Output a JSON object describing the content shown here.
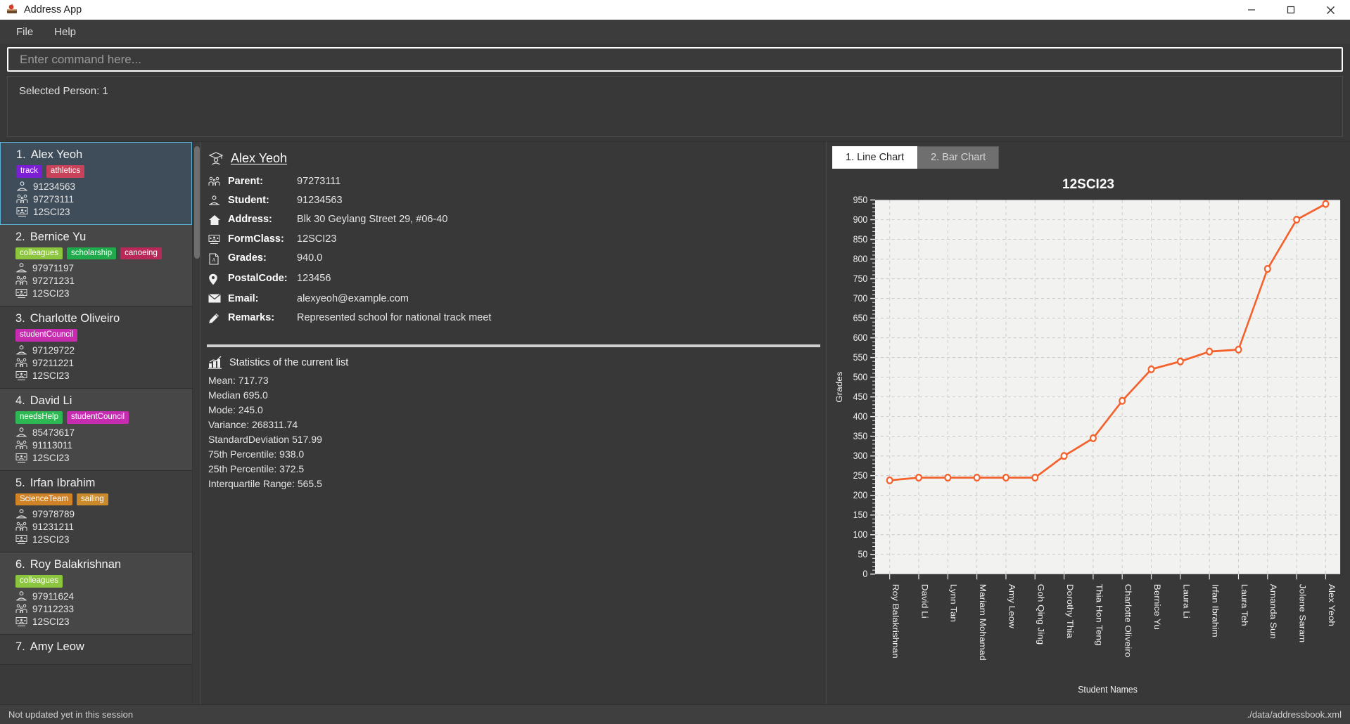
{
  "window": {
    "title": "Address App",
    "app_icon": "book-apple-icon",
    "buttons": {
      "minimize": "—",
      "maximize": "❐",
      "close": "✕"
    }
  },
  "menubar": {
    "items": [
      {
        "label": "File"
      },
      {
        "label": "Help"
      }
    ]
  },
  "command_box": {
    "placeholder": "Enter command here...",
    "value": ""
  },
  "result_box": {
    "text": "Selected Person: 1"
  },
  "person_list": {
    "scroll_position": "top",
    "items": [
      {
        "index": "1.",
        "name": "Alex Yeoh",
        "selected": true,
        "tags": [
          {
            "label": "track",
            "color": "#7c1fd4"
          },
          {
            "label": "athletics",
            "color": "#c8435a"
          }
        ],
        "student_phone": "91234563",
        "parent_phone": "97273111",
        "form_class": "12SCI23"
      },
      {
        "index": "2.",
        "name": "Bernice Yu",
        "selected": false,
        "tags": [
          {
            "label": "colleagues",
            "color": "#8cc63f"
          },
          {
            "label": "scholarship",
            "color": "#1faa4b"
          },
          {
            "label": "canoeing",
            "color": "#b8295a"
          }
        ],
        "student_phone": "97971197",
        "parent_phone": "97271231",
        "form_class": "12SCI23"
      },
      {
        "index": "3.",
        "name": "Charlotte Oliveiro",
        "selected": false,
        "tags": [
          {
            "label": "studentCouncil",
            "color": "#c62bb0"
          }
        ],
        "student_phone": "97129722",
        "parent_phone": "97211221",
        "form_class": "12SCI23"
      },
      {
        "index": "4.",
        "name": "David Li",
        "selected": false,
        "tags": [
          {
            "label": "needsHelp",
            "color": "#2eb853"
          },
          {
            "label": "studentCouncil",
            "color": "#c62bb0"
          }
        ],
        "student_phone": "85473617",
        "parent_phone": "91113011",
        "form_class": "12SCI23"
      },
      {
        "index": "5.",
        "name": "Irfan Ibrahim",
        "selected": false,
        "tags": [
          {
            "label": "ScienceTeam",
            "color": "#cf8326"
          },
          {
            "label": "sailing",
            "color": "#c98a2b"
          }
        ],
        "student_phone": "97978789",
        "parent_phone": "91231211",
        "form_class": "12SCI23"
      },
      {
        "index": "6.",
        "name": "Roy Balakrishnan",
        "selected": false,
        "tags": [
          {
            "label": "colleagues",
            "color": "#8cc63f"
          }
        ],
        "student_phone": "97911624",
        "parent_phone": "97112233",
        "form_class": "12SCI23"
      },
      {
        "index": "7.",
        "name": "Amy Leow",
        "selected": false,
        "tags": [],
        "student_phone": "",
        "parent_phone": "",
        "form_class": ""
      }
    ]
  },
  "person_detail": {
    "name": "Alex Yeoh",
    "name_icon": "graduate-icon",
    "fields": [
      {
        "icon": "parents-icon",
        "label": "Parent:",
        "value": "97273111"
      },
      {
        "icon": "student-icon",
        "label": "Student:",
        "value": "91234563"
      },
      {
        "icon": "home-icon",
        "label": "Address:",
        "value": "Blk 30 Geylang Street 29, #06-40"
      },
      {
        "icon": "class-icon",
        "label": "FormClass:",
        "value": "12SCI23"
      },
      {
        "icon": "grades-icon",
        "label": "Grades:",
        "value": "940.0"
      },
      {
        "icon": "location-icon",
        "label": "PostalCode:",
        "value": "123456"
      },
      {
        "icon": "email-icon",
        "label": "Email:",
        "value": "alexyeoh@example.com"
      },
      {
        "icon": "pencil-icon",
        "label": "Remarks:",
        "value": "Represented school for national track meet"
      }
    ]
  },
  "statistics": {
    "icon": "bar-chart-icon",
    "heading": "Statistics of the current list",
    "lines": [
      "Mean: 717.73",
      "Median 695.0",
      "Mode: 245.0",
      "Variance: 268311.74",
      "StandardDeviation 517.99",
      "75th Percentile: 938.0",
      "25th Percentile: 372.5",
      "Interquartile Range: 565.5"
    ]
  },
  "chart_tabs": [
    {
      "label": "1. Line Chart",
      "active": true
    },
    {
      "label": "2. Bar Chart",
      "active": false
    }
  ],
  "chart_data": {
    "type": "line",
    "title": "12SCI23",
    "xlabel": "Student Names",
    "ylabel": "Grades",
    "ylim": [
      0,
      950
    ],
    "ytick_step": 50,
    "grid": true,
    "legend": "none",
    "line_color": "#f4612c",
    "marker": "open-circle",
    "categories": [
      "Roy Balakrishnan",
      "David Li",
      "Lynn Tan",
      "Mariam Mohamad",
      "Amy Leow",
      "Goh Qing Jing",
      "Dorothy Thia",
      "Thia Hon Teng",
      "Charlotte Oliveiro",
      "Bernice Yu",
      "Laura Li",
      "Irfan Ibrahim",
      "Laura Teh",
      "Amanda Sun",
      "Jolene Saram",
      "Alex Yeoh"
    ],
    "values": [
      238,
      245,
      245,
      245,
      245,
      245,
      300,
      345,
      440,
      520,
      540,
      565,
      570,
      775,
      900,
      940
    ],
    "yticks": [
      0,
      50,
      100,
      150,
      200,
      250,
      300,
      350,
      400,
      450,
      500,
      550,
      600,
      650,
      700,
      750,
      800,
      850,
      900,
      950
    ]
  },
  "statusbar": {
    "left": "Not updated yet in this session",
    "right": "./data/addressbook.xml"
  }
}
